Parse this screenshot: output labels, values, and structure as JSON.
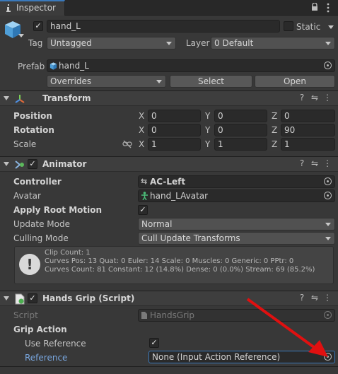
{
  "tab": {
    "label": "Inspector",
    "icon": "info-icon"
  },
  "tabbar_icons": {
    "lock": "lock-icon",
    "menu": "kebab-menu-icon"
  },
  "header": {
    "object_name": "hand_L",
    "active_checked": true,
    "static_label": "Static",
    "static_checked": false,
    "tag_label": "Tag",
    "tag_value": "Untagged",
    "layer_label": "Layer",
    "layer_value": "0 Default",
    "prefab_label": "Prefab",
    "prefab_value": "hand_L",
    "overrides_value": "Overrides",
    "select_label": "Select",
    "open_label": "Open"
  },
  "transform": {
    "title": "Transform",
    "rows": [
      {
        "label": "Position",
        "x": "0",
        "y": "0",
        "z": "0"
      },
      {
        "label": "Rotation",
        "x": "0",
        "y": "0",
        "z": "90"
      },
      {
        "label": "Scale",
        "x": "1",
        "y": "1",
        "z": "1"
      }
    ],
    "axis_x": "X",
    "axis_y": "Y",
    "axis_z": "Z"
  },
  "animator": {
    "title": "Animator",
    "enabled": true,
    "controller_label": "Controller",
    "controller_value": "AC-Left",
    "avatar_label": "Avatar",
    "avatar_value": "hand_LAvatar",
    "apply_root_motion_label": "Apply Root Motion",
    "apply_root_motion_checked": true,
    "update_mode_label": "Update Mode",
    "update_mode_value": "Normal",
    "culling_mode_label": "Culling Mode",
    "culling_mode_value": "Cull Update Transforms",
    "info_lines": [
      "Clip Count: 1",
      "Curves Pos: 13 Quat: 0 Euler: 14 Scale: 0 Muscles: 0 Generic: 0 PPtr: 0",
      "Curves Count: 81 Constant: 12 (14.8%) Dense: 0 (0.0%) Stream: 69 (85.2%)"
    ]
  },
  "hands_grip": {
    "title": "Hands Grip (Script)",
    "enabled": true,
    "script_label": "Script",
    "script_value": "HandsGrip",
    "grip_action_label": "Grip Action",
    "use_reference_label": "Use Reference",
    "use_reference_checked": true,
    "reference_label": "Reference",
    "reference_value": "None (Input Action Reference)"
  },
  "colors": {
    "background": "#383838",
    "accent_blue": "#79a7e0",
    "arrow_red": "#e01010",
    "field_dark": "#2a2a2a"
  }
}
